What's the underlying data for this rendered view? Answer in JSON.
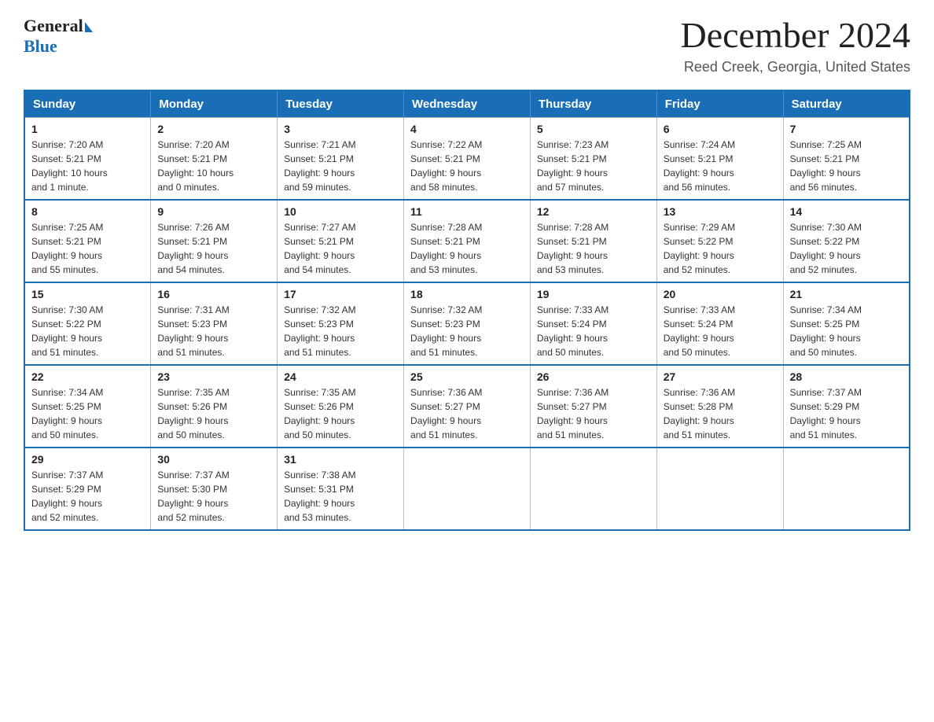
{
  "header": {
    "logo": {
      "general": "General",
      "arrow": "▶",
      "blue": "Blue"
    },
    "title": "December 2024",
    "location": "Reed Creek, Georgia, United States"
  },
  "days_of_week": [
    "Sunday",
    "Monday",
    "Tuesday",
    "Wednesday",
    "Thursday",
    "Friday",
    "Saturday"
  ],
  "weeks": [
    [
      {
        "day": "1",
        "info": "Sunrise: 7:20 AM\nSunset: 5:21 PM\nDaylight: 10 hours\nand 1 minute."
      },
      {
        "day": "2",
        "info": "Sunrise: 7:20 AM\nSunset: 5:21 PM\nDaylight: 10 hours\nand 0 minutes."
      },
      {
        "day": "3",
        "info": "Sunrise: 7:21 AM\nSunset: 5:21 PM\nDaylight: 9 hours\nand 59 minutes."
      },
      {
        "day": "4",
        "info": "Sunrise: 7:22 AM\nSunset: 5:21 PM\nDaylight: 9 hours\nand 58 minutes."
      },
      {
        "day": "5",
        "info": "Sunrise: 7:23 AM\nSunset: 5:21 PM\nDaylight: 9 hours\nand 57 minutes."
      },
      {
        "day": "6",
        "info": "Sunrise: 7:24 AM\nSunset: 5:21 PM\nDaylight: 9 hours\nand 56 minutes."
      },
      {
        "day": "7",
        "info": "Sunrise: 7:25 AM\nSunset: 5:21 PM\nDaylight: 9 hours\nand 56 minutes."
      }
    ],
    [
      {
        "day": "8",
        "info": "Sunrise: 7:25 AM\nSunset: 5:21 PM\nDaylight: 9 hours\nand 55 minutes."
      },
      {
        "day": "9",
        "info": "Sunrise: 7:26 AM\nSunset: 5:21 PM\nDaylight: 9 hours\nand 54 minutes."
      },
      {
        "day": "10",
        "info": "Sunrise: 7:27 AM\nSunset: 5:21 PM\nDaylight: 9 hours\nand 54 minutes."
      },
      {
        "day": "11",
        "info": "Sunrise: 7:28 AM\nSunset: 5:21 PM\nDaylight: 9 hours\nand 53 minutes."
      },
      {
        "day": "12",
        "info": "Sunrise: 7:28 AM\nSunset: 5:21 PM\nDaylight: 9 hours\nand 53 minutes."
      },
      {
        "day": "13",
        "info": "Sunrise: 7:29 AM\nSunset: 5:22 PM\nDaylight: 9 hours\nand 52 minutes."
      },
      {
        "day": "14",
        "info": "Sunrise: 7:30 AM\nSunset: 5:22 PM\nDaylight: 9 hours\nand 52 minutes."
      }
    ],
    [
      {
        "day": "15",
        "info": "Sunrise: 7:30 AM\nSunset: 5:22 PM\nDaylight: 9 hours\nand 51 minutes."
      },
      {
        "day": "16",
        "info": "Sunrise: 7:31 AM\nSunset: 5:23 PM\nDaylight: 9 hours\nand 51 minutes."
      },
      {
        "day": "17",
        "info": "Sunrise: 7:32 AM\nSunset: 5:23 PM\nDaylight: 9 hours\nand 51 minutes."
      },
      {
        "day": "18",
        "info": "Sunrise: 7:32 AM\nSunset: 5:23 PM\nDaylight: 9 hours\nand 51 minutes."
      },
      {
        "day": "19",
        "info": "Sunrise: 7:33 AM\nSunset: 5:24 PM\nDaylight: 9 hours\nand 50 minutes."
      },
      {
        "day": "20",
        "info": "Sunrise: 7:33 AM\nSunset: 5:24 PM\nDaylight: 9 hours\nand 50 minutes."
      },
      {
        "day": "21",
        "info": "Sunrise: 7:34 AM\nSunset: 5:25 PM\nDaylight: 9 hours\nand 50 minutes."
      }
    ],
    [
      {
        "day": "22",
        "info": "Sunrise: 7:34 AM\nSunset: 5:25 PM\nDaylight: 9 hours\nand 50 minutes."
      },
      {
        "day": "23",
        "info": "Sunrise: 7:35 AM\nSunset: 5:26 PM\nDaylight: 9 hours\nand 50 minutes."
      },
      {
        "day": "24",
        "info": "Sunrise: 7:35 AM\nSunset: 5:26 PM\nDaylight: 9 hours\nand 50 minutes."
      },
      {
        "day": "25",
        "info": "Sunrise: 7:36 AM\nSunset: 5:27 PM\nDaylight: 9 hours\nand 51 minutes."
      },
      {
        "day": "26",
        "info": "Sunrise: 7:36 AM\nSunset: 5:27 PM\nDaylight: 9 hours\nand 51 minutes."
      },
      {
        "day": "27",
        "info": "Sunrise: 7:36 AM\nSunset: 5:28 PM\nDaylight: 9 hours\nand 51 minutes."
      },
      {
        "day": "28",
        "info": "Sunrise: 7:37 AM\nSunset: 5:29 PM\nDaylight: 9 hours\nand 51 minutes."
      }
    ],
    [
      {
        "day": "29",
        "info": "Sunrise: 7:37 AM\nSunset: 5:29 PM\nDaylight: 9 hours\nand 52 minutes."
      },
      {
        "day": "30",
        "info": "Sunrise: 7:37 AM\nSunset: 5:30 PM\nDaylight: 9 hours\nand 52 minutes."
      },
      {
        "day": "31",
        "info": "Sunrise: 7:38 AM\nSunset: 5:31 PM\nDaylight: 9 hours\nand 53 minutes."
      },
      {
        "day": "",
        "info": ""
      },
      {
        "day": "",
        "info": ""
      },
      {
        "day": "",
        "info": ""
      },
      {
        "day": "",
        "info": ""
      }
    ]
  ]
}
